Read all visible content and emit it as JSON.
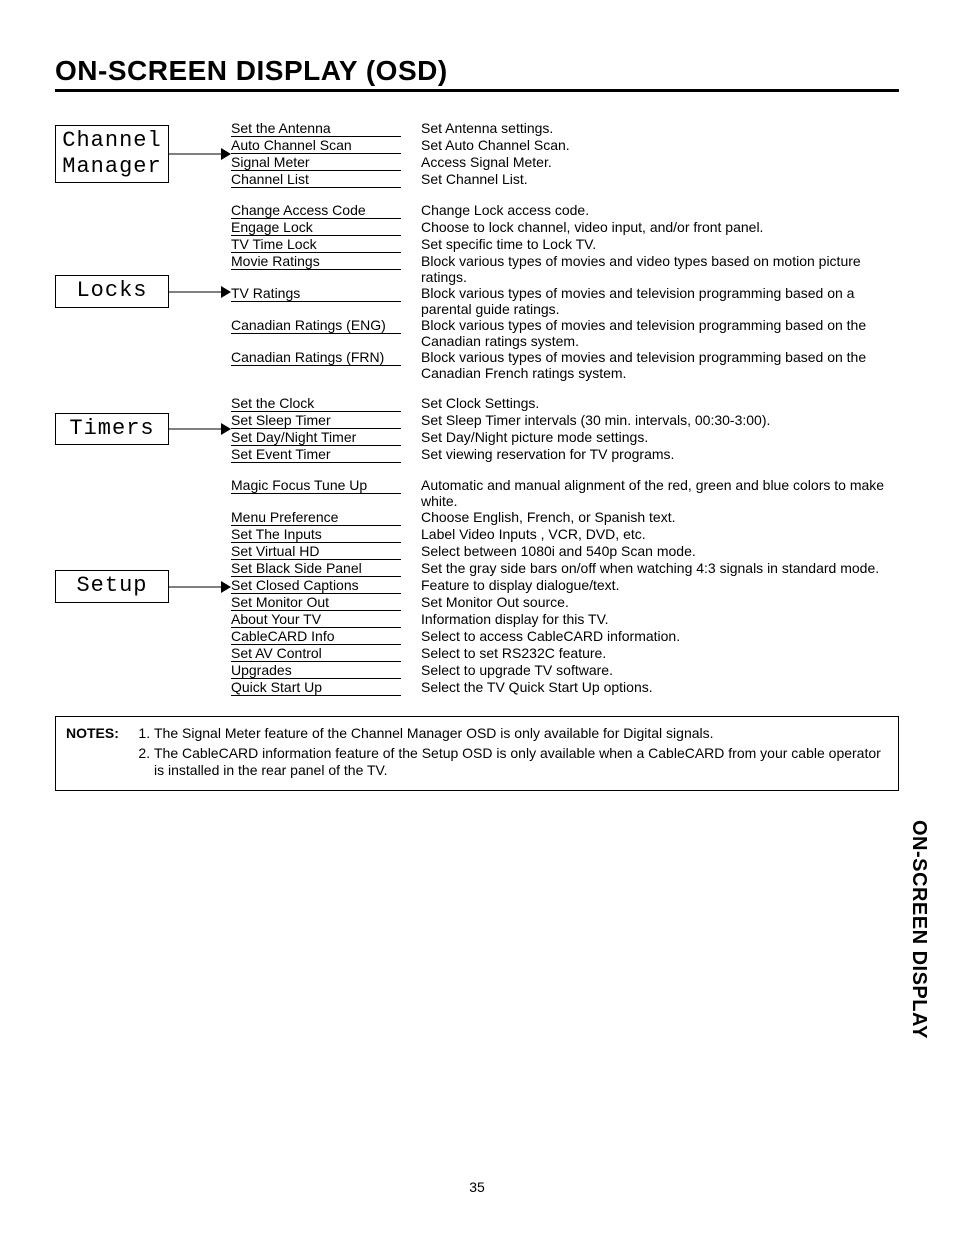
{
  "title": "ON-SCREEN DISPLAY (OSD)",
  "sections": [
    {
      "label": "Channel\nManager",
      "rows": [
        {
          "item": "Set the Antenna",
          "desc": "Set Antenna settings."
        },
        {
          "item": "Auto Channel Scan",
          "desc": "Set Auto Channel Scan."
        },
        {
          "item": "Signal Meter",
          "desc": "Access Signal Meter."
        },
        {
          "item": "Channel List",
          "desc": "Set Channel List."
        }
      ]
    },
    {
      "label": "Locks",
      "rows": [
        {
          "item": "Change Access Code",
          "desc": "Change Lock access code."
        },
        {
          "item": "Engage Lock",
          "desc": "Choose to lock channel, video input, and/or front panel."
        },
        {
          "item": "TV Time Lock",
          "desc": "Set specific time to Lock TV."
        },
        {
          "item": "Movie Ratings",
          "desc": "Block various types of movies and video types based on motion picture ratings."
        },
        {
          "item": "TV Ratings",
          "desc": "Block various types of movies and television programming based on a parental guide ratings."
        },
        {
          "item": "Canadian Ratings (ENG)",
          "desc": "Block various types of movies and television programming based on the Canadian ratings system."
        },
        {
          "item": "Canadian Ratings (FRN)",
          "desc": "Block various types of movies and television programming based on the Canadian French ratings system."
        }
      ]
    },
    {
      "label": "Timers",
      "rows": [
        {
          "item": "Set the Clock",
          "desc": "Set Clock Settings."
        },
        {
          "item": "Set Sleep Timer",
          "desc": "Set Sleep Timer intervals (30 min. intervals, 00:30-3:00)."
        },
        {
          "item": "Set Day/Night Timer",
          "desc": "Set Day/Night picture mode settings."
        },
        {
          "item": "Set Event Timer",
          "desc": "Set viewing reservation for TV programs."
        }
      ]
    },
    {
      "label": "Setup",
      "rows": [
        {
          "item": "Magic Focus Tune Up",
          "desc": "Automatic and manual alignment of the red, green and blue colors to make white."
        },
        {
          "item": "Menu Preference",
          "desc": "Choose English, French, or Spanish text."
        },
        {
          "item": "Set The Inputs",
          "desc": "Label Video Inputs , VCR, DVD, etc."
        },
        {
          "item": "Set Virtual HD",
          "desc": "Select between 1080i and 540p Scan mode."
        },
        {
          "item": "Set Black Side Panel",
          "desc": "Set the gray side bars on/off when watching 4:3 signals in standard mode."
        },
        {
          "item": "Set Closed Captions",
          "desc": "Feature to display dialogue/text."
        },
        {
          "item": "Set Monitor Out",
          "desc": "Set Monitor Out source."
        },
        {
          "item": "About Your TV",
          "desc": "Information display for this TV."
        },
        {
          "item": "CableCARD Info",
          "desc": "Select to access CableCARD information."
        },
        {
          "item": "Set AV Control",
          "desc": "Select to set RS232C feature."
        },
        {
          "item": "Upgrades",
          "desc": "Select to upgrade TV software."
        },
        {
          "item": "Quick Start Up",
          "desc": "Select the TV Quick Start Up options."
        }
      ]
    }
  ],
  "notes": {
    "label": "NOTES:",
    "items": [
      "The Signal Meter feature of the Channel Manager OSD is only available for Digital signals.",
      "The CableCARD information feature of the Setup OSD is only available when a CableCARD from your cable operator is installed in the rear panel of the TV."
    ]
  },
  "side_tab": "ON-SCREEN DISPLAY",
  "page_number": "35"
}
